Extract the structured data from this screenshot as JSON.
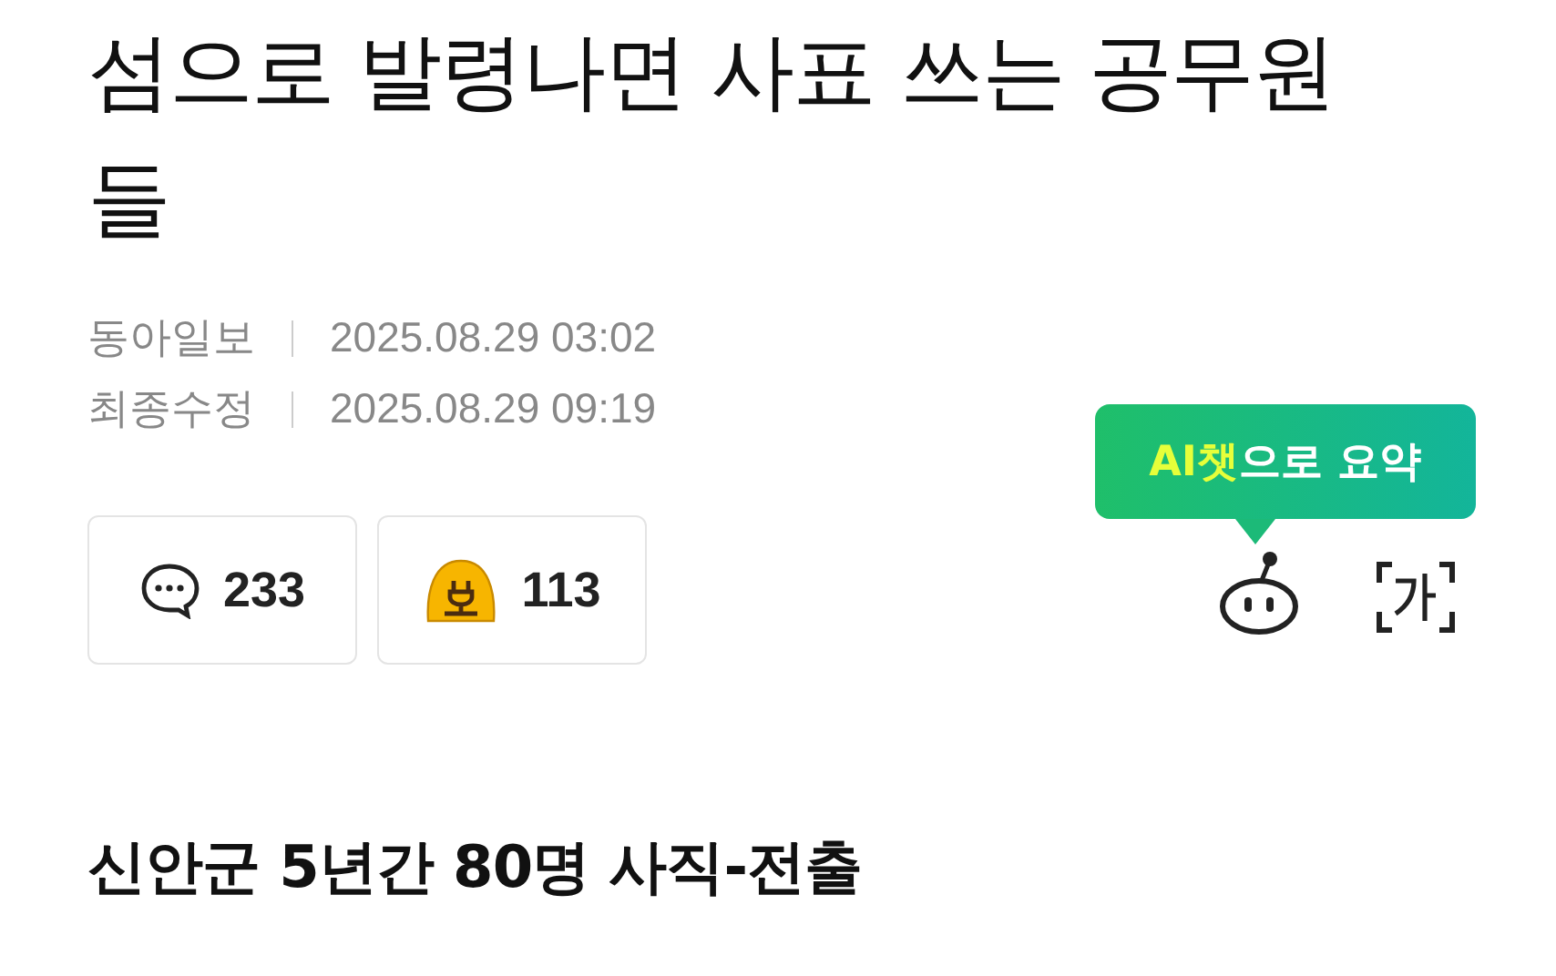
{
  "headline": "섬으로 발령나면 사표 쓰는 공무원들",
  "meta": [
    {
      "label": "동아일보",
      "value": "2025.08.29 03:02"
    },
    {
      "label": "최종수정",
      "value": "2025.08.29 09:19"
    }
  ],
  "reactions": [
    {
      "kind": "comment",
      "count": "233"
    },
    {
      "kind": "emoji",
      "count": "113"
    }
  ],
  "ai_tooltip": {
    "highlight": "AI챗",
    "rest": "으로 요약"
  },
  "subheading": "신안군 5년간 80명 사직-전출"
}
